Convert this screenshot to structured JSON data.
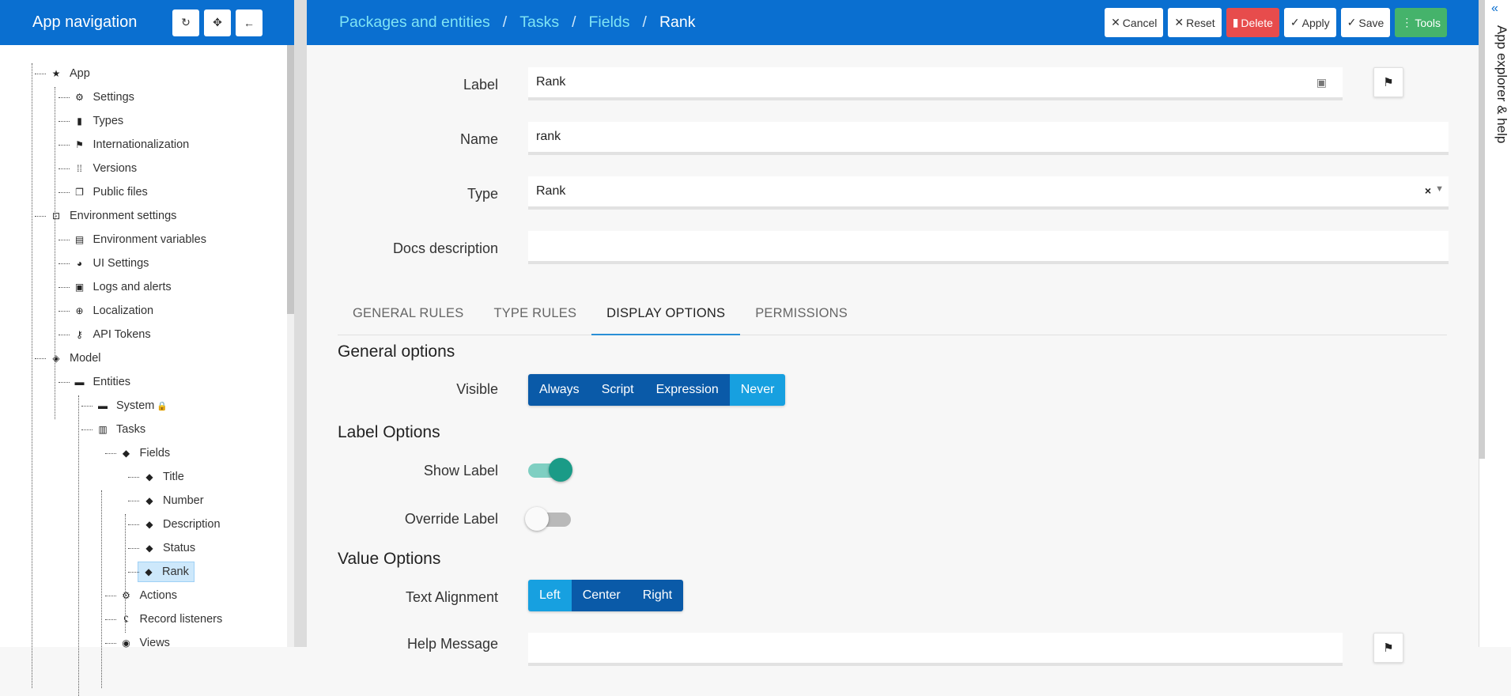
{
  "nav": {
    "title": "App navigation",
    "buttons": [
      {
        "name": "refresh-icon",
        "glyph": "↻"
      },
      {
        "name": "crosshair-icon",
        "glyph": "✥"
      },
      {
        "name": "arrow-left-icon",
        "glyph": "←"
      }
    ],
    "tree": [
      {
        "label": "App",
        "icon": "star-icon",
        "glyph": "★",
        "level": 0
      },
      {
        "label": "Settings",
        "icon": "gear-icon",
        "glyph": "⚙",
        "level": 1
      },
      {
        "label": "Types",
        "icon": "book-icon",
        "glyph": "▮",
        "level": 1
      },
      {
        "label": "Internationalization",
        "icon": "flag-icon",
        "glyph": "⚑",
        "level": 1
      },
      {
        "label": "Versions",
        "icon": "grid-icon",
        "glyph": "⁞⁞",
        "level": 1
      },
      {
        "label": "Public files",
        "icon": "copy-icon",
        "glyph": "❐",
        "level": 1
      },
      {
        "label": "Environment settings",
        "icon": "environment-icon",
        "glyph": "⊡",
        "level": 0
      },
      {
        "label": "Environment variables",
        "icon": "clipboard-icon",
        "glyph": "▤",
        "level": 1
      },
      {
        "label": "UI Settings",
        "icon": "palette-icon",
        "glyph": "◕",
        "level": 1
      },
      {
        "label": "Logs and alerts",
        "icon": "comment-icon",
        "glyph": "▣",
        "level": 1
      },
      {
        "label": "Localization",
        "icon": "globe-icon",
        "glyph": "⊕",
        "level": 1
      },
      {
        "label": "API Tokens",
        "icon": "key-icon",
        "glyph": "⚷",
        "level": 1
      },
      {
        "label": "Model",
        "icon": "layers-icon",
        "glyph": "◈",
        "level": 0
      },
      {
        "label": "Entities",
        "icon": "folder-icon",
        "glyph": "▬",
        "level": 1
      },
      {
        "label": "System",
        "icon": "folder-icon",
        "glyph": "▬",
        "level": 2,
        "locked": true
      },
      {
        "label": "Tasks",
        "icon": "entity-icon",
        "glyph": "▥",
        "level": 2
      },
      {
        "label": "Fields",
        "icon": "tags-icon",
        "glyph": "◆",
        "level": 3
      },
      {
        "label": "Title",
        "icon": "tag-icon",
        "glyph": "◆",
        "level": 4
      },
      {
        "label": "Number",
        "icon": "tag-icon",
        "glyph": "◆",
        "level": 4
      },
      {
        "label": "Description",
        "icon": "tag-icon",
        "glyph": "◆",
        "level": 4
      },
      {
        "label": "Status",
        "icon": "tag-icon",
        "glyph": "◆",
        "level": 4
      },
      {
        "label": "Rank",
        "icon": "tag-icon",
        "glyph": "◆",
        "level": 4,
        "selected": true
      },
      {
        "label": "Actions",
        "icon": "gear-icon",
        "glyph": "⚙",
        "level": 3
      },
      {
        "label": "Record listeners",
        "icon": "ear-icon",
        "glyph": "ʢ",
        "level": 3
      },
      {
        "label": "Views",
        "icon": "eye-icon",
        "glyph": "◉",
        "level": 3
      }
    ]
  },
  "breadcrumb": [
    "Packages and entities",
    "Tasks",
    "Fields",
    "Rank"
  ],
  "actions": [
    {
      "label": "Cancel",
      "glyph": "✕",
      "style": "default"
    },
    {
      "label": "Reset",
      "glyph": "✕",
      "style": "default"
    },
    {
      "label": "Delete",
      "glyph": "▮",
      "style": "danger"
    },
    {
      "label": "Apply",
      "glyph": "✓",
      "style": "default"
    },
    {
      "label": "Save",
      "glyph": "✓",
      "style": "default"
    },
    {
      "label": "Tools",
      "glyph": "⋮",
      "style": "success"
    }
  ],
  "form": {
    "label": {
      "label": "Label",
      "value": "Rank"
    },
    "name": {
      "label": "Name",
      "value": "rank"
    },
    "type": {
      "label": "Type",
      "value": "Rank"
    },
    "docs": {
      "label": "Docs description",
      "value": ""
    },
    "help": {
      "label": "Help Message",
      "value": ""
    }
  },
  "tabs": [
    "GENERAL RULES",
    "TYPE RULES",
    "DISPLAY OPTIONS",
    "PERMISSIONS"
  ],
  "active_tab": "DISPLAY OPTIONS",
  "general_options": {
    "title": "General options",
    "visible_label": "Visible",
    "visible_options": [
      "Always",
      "Script",
      "Expression",
      "Never"
    ],
    "visible_selected": "Never"
  },
  "label_options": {
    "title": "Label Options",
    "show_label": "Show Label",
    "show_label_on": true,
    "override_label": "Override Label",
    "override_label_on": false
  },
  "value_options": {
    "title": "Value Options",
    "alignment_label": "Text Alignment",
    "alignment_options": [
      "Left",
      "Center",
      "Right"
    ],
    "alignment_selected": "Left"
  },
  "right_panel": {
    "title": "App explorer & help"
  },
  "colors": {
    "primary": "#0a6fd0",
    "crumb": "#7fe3f4",
    "danger": "#e74c4c",
    "success": "#45b36b",
    "seg": "#0a5aa8",
    "seg_on": "#17a0e0",
    "switch_on": "#1a9b87"
  }
}
